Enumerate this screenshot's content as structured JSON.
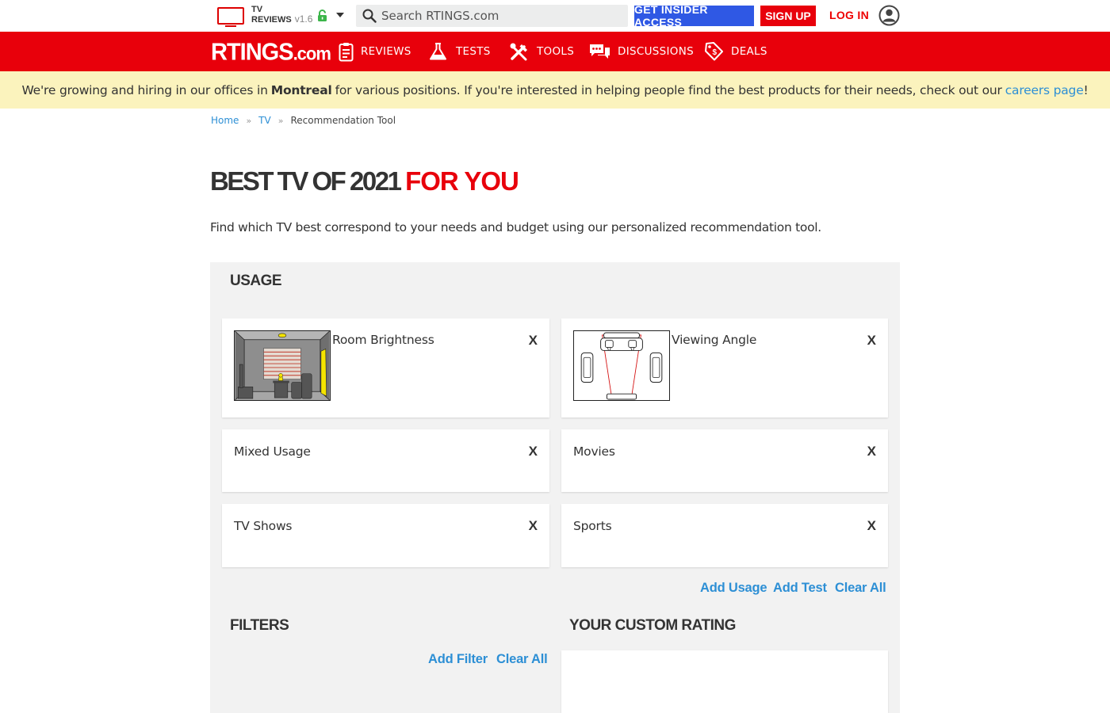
{
  "topbar": {
    "product_line1": "TV",
    "product_line2": "REVIEWS",
    "version": "v1.6",
    "search_placeholder": "Search RTINGS.com",
    "insider_label": "GET INSIDER ACCESS",
    "signup_label": "SIGN UP",
    "login_label": "LOG IN",
    "icons": [
      "tv-icon",
      "lock-icon",
      "caret-down-icon",
      "search-icon",
      "user-icon"
    ]
  },
  "nav": {
    "logo_main": "RTINGS",
    "logo_suffix": ".com",
    "items": [
      {
        "label": "REVIEWS",
        "icon": "clipboard-icon"
      },
      {
        "label": "TESTS",
        "icon": "flask-icon"
      },
      {
        "label": "TOOLS",
        "icon": "tools-icon"
      },
      {
        "label": "DISCUSSIONS",
        "icon": "chat-icon"
      },
      {
        "label": "DEALS",
        "icon": "price-tag-icon"
      }
    ]
  },
  "banner": {
    "text_before": "We're growing and hiring in our offices in",
    "city": "Montreal",
    "text_after": "for various positions. If you're interested in helping people find the best products for their needs, check out our",
    "link_text": "careers page",
    "end": "!"
  },
  "breadcrumb": {
    "home": "Home",
    "tv": "TV",
    "current": "Recommendation Tool"
  },
  "page": {
    "title_main": "BEST TV OF 2021",
    "title_accent": "FOR YOU",
    "intro": "Find which TV best correspond to your needs and budget using our personalized recommendation tool."
  },
  "usage": {
    "heading": "USAGE",
    "remove_label": "X",
    "cards": [
      {
        "label": "Room Brightness",
        "image": "room-brightness-illustration"
      },
      {
        "label": "Viewing Angle",
        "image": "viewing-angle-illustration"
      },
      {
        "label": "Mixed Usage"
      },
      {
        "label": "Movies"
      },
      {
        "label": "TV Shows"
      },
      {
        "label": "Sports"
      }
    ],
    "add_usage": "Add Usage",
    "add_test": "Add Test",
    "clear_all": "Clear All"
  },
  "filters": {
    "heading": "FILTERS",
    "add_filter": "Add Filter",
    "clear_all": "Clear All"
  },
  "custom_rating": {
    "heading": "YOUR CUSTOM RATING"
  },
  "colors": {
    "brand_red": "#e8000b",
    "insider_blue": "#2f58e4",
    "link_blue": "#2d8fd5",
    "banner_yellow": "#fbf3bd",
    "panel_gray": "#f2f2f2"
  }
}
